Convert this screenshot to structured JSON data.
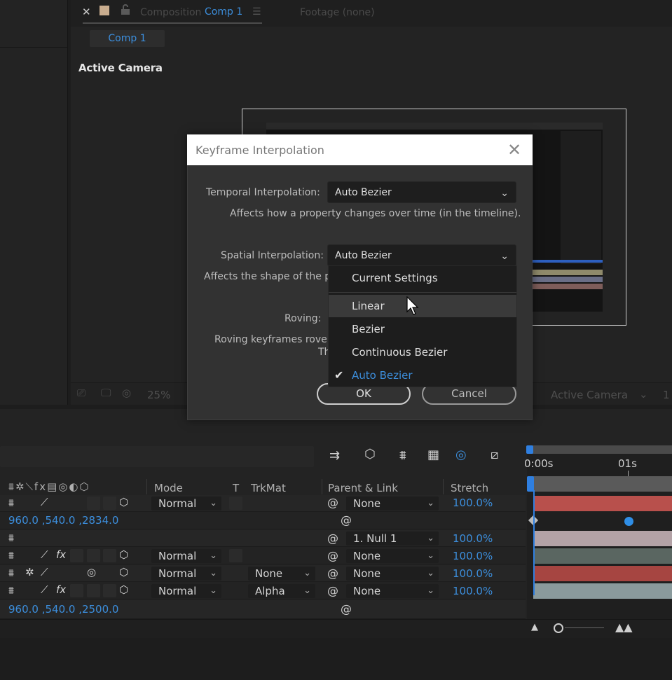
{
  "composition_panel": {
    "tab_label": "Composition",
    "tab_comp_name": "Comp 1",
    "footage_tab": "Footage  (none)",
    "sub_tab": "Comp 1",
    "view_label": "Active Camera",
    "zoom": "25%",
    "camera_dropdown": "Active Camera",
    "views_count": "1"
  },
  "timeline": {
    "ruler_start": "0:00s",
    "ruler_mark": "01s",
    "columns": {
      "mode": "Mode",
      "t": "T",
      "trkmat": "TrkMat",
      "parent_link": "Parent & Link",
      "stretch": "Stretch"
    },
    "rows": [
      {
        "mode": "Normal",
        "trkmat": "",
        "parent": "None",
        "stretch": "100.0%"
      },
      {
        "coords": "960.0 ,540.0 ,2834.0"
      },
      {
        "mode": "",
        "trkmat": "",
        "parent": "1. Null 1",
        "stretch": "100.0%"
      },
      {
        "mode": "Normal",
        "trkmat": "",
        "parent": "None",
        "stretch": "100.0%"
      },
      {
        "mode": "Normal",
        "trkmat": "None",
        "parent": "None",
        "stretch": "100.0%"
      },
      {
        "mode": "Normal",
        "trkmat": "Alpha",
        "parent": "None",
        "stretch": "100.0%"
      },
      {
        "coords": "960.0 ,540.0 ,2500.0"
      }
    ],
    "bar_colors": [
      "#b8504c",
      "#b3a2a6",
      "#5a6661",
      "#a64541",
      "#8a9a9c"
    ]
  },
  "dialog": {
    "title": "Keyframe Interpolation",
    "temporal_label": "Temporal Interpolation:",
    "temporal_value": "Auto Bezier",
    "temporal_hint": "Affects how a property changes over time (in the timeline).",
    "spatial_label": "Spatial Interpolation:",
    "spatial_value": "Auto Bezier",
    "spatial_hint": "Affects the shape of the pa",
    "roving_label": "Roving:",
    "roving_hint": "Roving keyframes rove ir",
    "roving_hint2": "Th",
    "ok_label": "OK",
    "cancel_label": "Cancel"
  },
  "menu": {
    "items": [
      {
        "label": "Current Settings"
      },
      {
        "label": "Linear"
      },
      {
        "label": "Bezier"
      },
      {
        "label": "Continuous Bezier"
      },
      {
        "label": "Auto Bezier"
      }
    ]
  },
  "colors": {
    "accent": "#3c8edc",
    "dialog_bg": "#323232"
  }
}
